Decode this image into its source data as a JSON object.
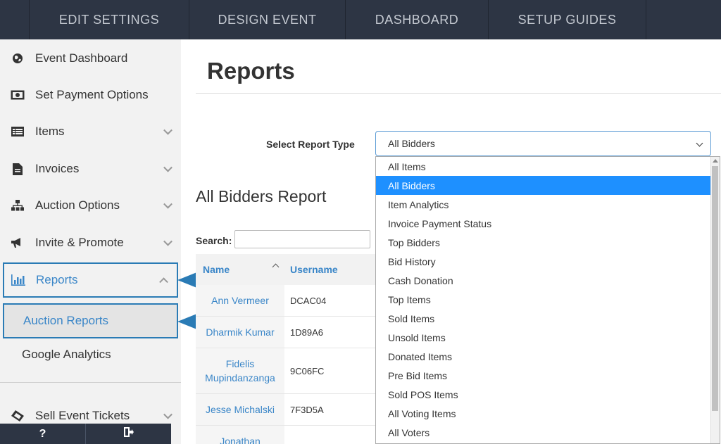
{
  "topnav": {
    "tabs": [
      "EDIT SETTINGS",
      "DESIGN EVENT",
      "DASHBOARD",
      "SETUP GUIDES"
    ]
  },
  "sidebar": {
    "items": [
      {
        "label": "Event Dashboard",
        "icon": "globe-icon"
      },
      {
        "label": "Set Payment Options",
        "icon": "money-icon"
      },
      {
        "label": "Items",
        "icon": "list-icon"
      },
      {
        "label": "Invoices",
        "icon": "document-icon"
      },
      {
        "label": "Auction Options",
        "icon": "sitemap-icon"
      },
      {
        "label": "Invite & Promote",
        "icon": "megaphone-icon"
      },
      {
        "label": "Reports",
        "icon": "bar-chart-icon"
      }
    ],
    "sub_items": [
      "Auction Reports",
      "Google Analytics"
    ],
    "extra_item": {
      "label": "Sell Event Tickets",
      "icon": "ticket-icon"
    },
    "bottom": {
      "help": "?",
      "logout_icon": "sign-out-icon"
    }
  },
  "main": {
    "title": "Reports",
    "select_label": "Select Report Type",
    "select_value": "All Bidders",
    "report_title": "All Bidders Report",
    "search_label": "Search:",
    "table": {
      "headers": [
        "Name",
        "Username"
      ],
      "rows": [
        {
          "name": "Ann Vermeer",
          "username": "DCAC04"
        },
        {
          "name": "Dharmik Kumar",
          "username": "1D89A6"
        },
        {
          "name": "Fidelis Mupindanzanga",
          "username": "9C06FC"
        },
        {
          "name": "Jesse Michalski",
          "username": "7F3D5A"
        },
        {
          "name": "Jonathan",
          "username": ""
        }
      ]
    },
    "dropdown_options": [
      "All Items",
      "All Bidders",
      "Item Analytics",
      "Invoice Payment Status",
      "Top Bidders",
      "Bid History",
      "Cash Donation",
      "Top Items",
      "Sold Items",
      "Unsold Items",
      "Donated Items",
      "Pre Bid Items",
      "Sold POS Items",
      "All Voting Items",
      "All Voters"
    ],
    "selected_option": "All Bidders"
  },
  "colors": {
    "nav_bg": "#2d3544",
    "accent": "#3a86c8",
    "highlight": "#1e90ff",
    "callout": "#2a7bb5"
  }
}
